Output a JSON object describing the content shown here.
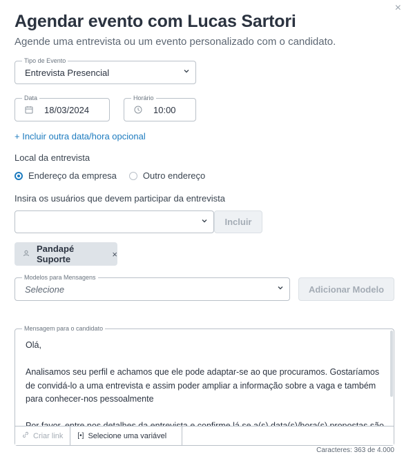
{
  "dialog": {
    "close_icon": "×",
    "title": "Agendar evento com Lucas Sartori",
    "subtitle": "Agende uma entrevista ou um evento personalizado com o candidato."
  },
  "event_type": {
    "legend": "Tipo de Evento",
    "value": "Entrevista Presencial"
  },
  "date": {
    "legend": "Data",
    "value": "18/03/2024",
    "icon": "calendar-icon"
  },
  "time": {
    "legend": "Horário",
    "value": "10:00",
    "icon": "clock-icon"
  },
  "add_datetime_link": "+ Incluir outra data/hora opcional",
  "location": {
    "label": "Local da entrevista",
    "options": [
      {
        "label": "Endereço da empresa",
        "selected": true
      },
      {
        "label": "Outro endereço",
        "selected": false
      }
    ]
  },
  "participants": {
    "label": "Insira os usuários que devem participar da entrevista",
    "input_value": "",
    "include_button": "Incluir",
    "chips": [
      {
        "name": "Pandapé Suporte",
        "icon": "user-icon",
        "remove": "×"
      }
    ]
  },
  "templates": {
    "legend": "Modelos para Mensagens",
    "placeholder": "Selecione",
    "add_button": "Adicionar Modelo"
  },
  "message": {
    "legend": "Mensagem para o candidato",
    "paragraphs": [
      "Olá,",
      "Analisamos seu perfil e achamos que ele pode adaptar-se ao que procuramos. Gostaríamos de convidá-lo a uma entrevista e assim poder ampliar a informação sobre a vaga e também para conhecer-nos pessoalmente",
      "Por favor, entre nos detalhes da entrevista e confirme lá se a(s) data(s)/hora(s) propostas são"
    ],
    "toolbar": {
      "create_link": "Criar link",
      "variable": "Selecione uma variável"
    },
    "counter": "Caracteres: 363 de 4.000"
  },
  "colors": {
    "accent": "#1d7bbf",
    "text": "#2b3340",
    "border": "#b9c0c8"
  }
}
